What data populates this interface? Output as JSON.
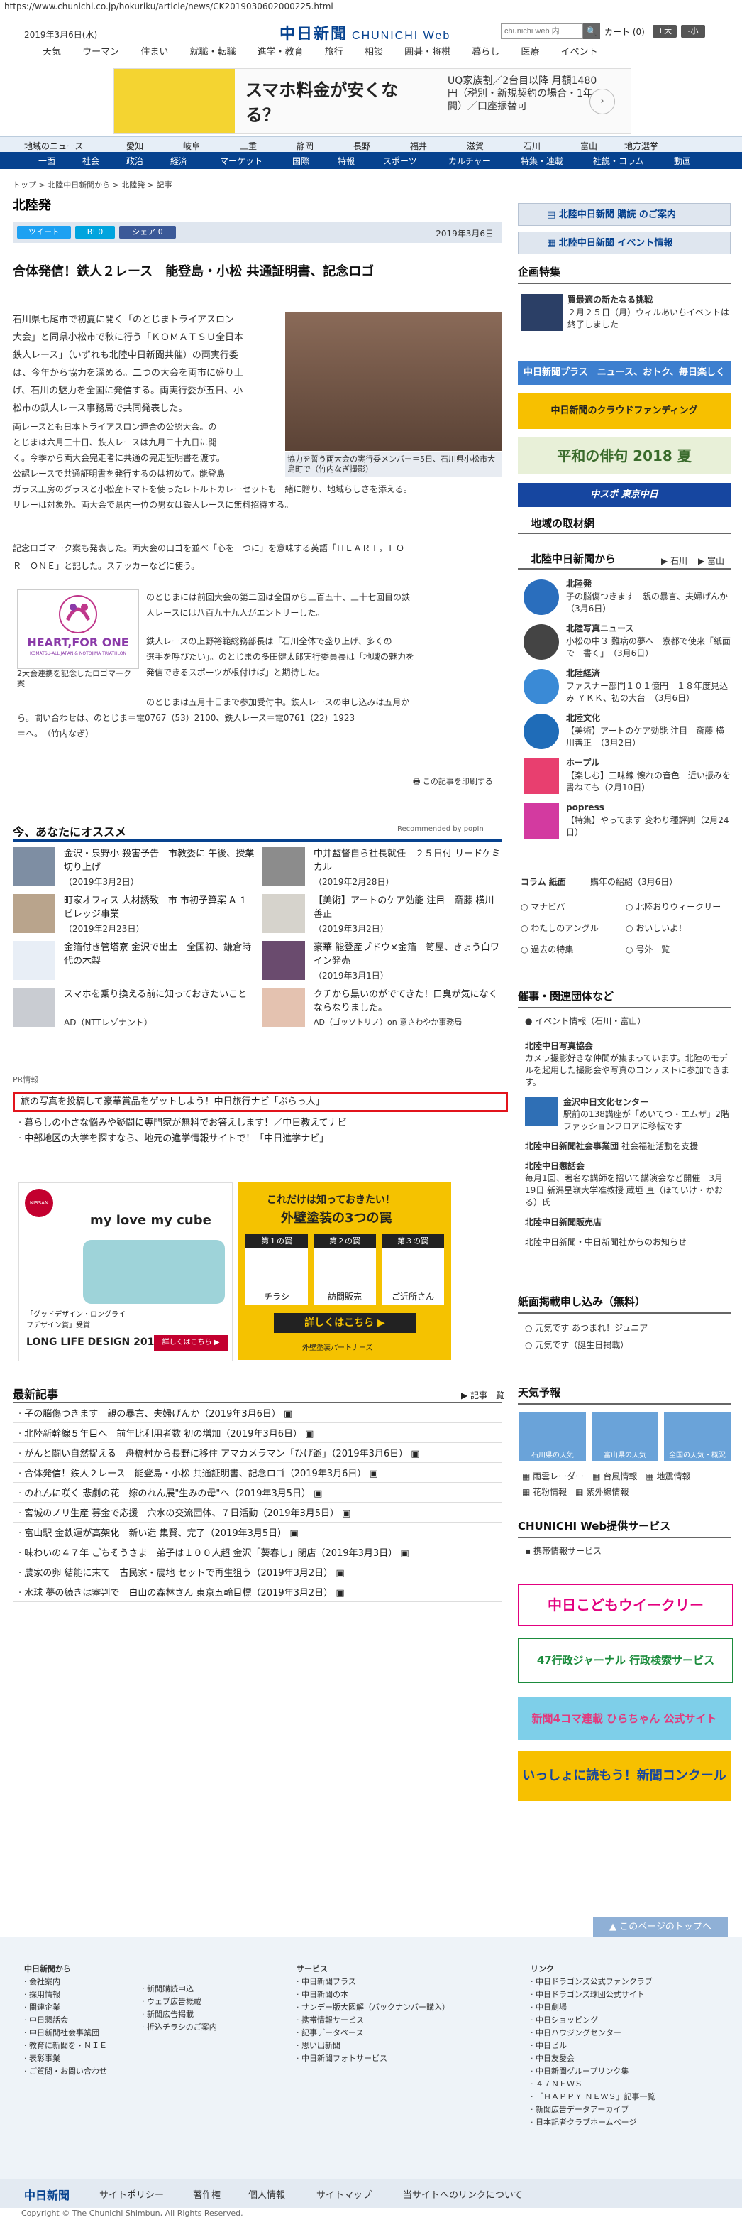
{
  "url": "https://www.chunichi.co.jp/hokuriku/article/news/CK2019030602000225.html",
  "header": {
    "date": "2019年3月6日(水)",
    "logo": "中日新聞",
    "logo_sub": "CHUNICHI Web",
    "search_placeholder": "chunichi web 内",
    "search_btn": "🔍",
    "cart": "カート (0)",
    "font_up": "+大",
    "font_down": "-小",
    "categories": [
      "天気",
      "ウーマン",
      "住まい",
      "就職・転職",
      "進学・教育",
      "旅行",
      "相談",
      "囲碁・将棋",
      "暮らし",
      "医療",
      "イベント"
    ]
  },
  "ad_top": {
    "title": "スマホ料金が安くなる？",
    "text": "UQ家族割／2台目以降 月額1480円（税別・新規契約の場合・1年間）／口座振替可"
  },
  "region_nav": [
    "地域のニュース",
    "愛知",
    "岐阜",
    "三重",
    "静岡",
    "長野",
    "福井",
    "滋賀",
    "石川",
    "富山",
    "地方選挙"
  ],
  "section_nav": [
    "一面",
    "社会",
    "政治",
    "経済",
    "マーケット",
    "国際",
    "特報",
    "スポーツ",
    "カルチャー",
    "特集・連載",
    "社説・コラム",
    "動画"
  ],
  "breadcrumb": "トップ > 北陸中日新聞から > 北陸発 > 記事",
  "section_title": "北陸発",
  "share": {
    "tweet": "ツイート",
    "hatena": "B! 0",
    "fb": "シェア 0"
  },
  "article": {
    "date": "2019年3月6日",
    "title": "合体発信！鉄人２レース　能登島・小松 共通証明書、記念ロゴ",
    "p1": [
      "石川県七尾市で初夏に開く「のとじまトライアスロン",
      "大会」と同県小松市で秋に行う「ＫＯＭＡＴＳＵ全日本",
      "鉄人レース」（いずれも北陸中日新聞共催）の両実行委",
      "は、今年から協力を深める。二つの大会を両市に盛り上",
      "げ、石川の魅力を全国に発信する。両実行委が五日、小",
      "松市の鉄人レース事務局で共同発表した。"
    ],
    "p2": [
      "両レースとも日本トライアスロン連合の公認大会。の",
      "とじまは六月三十日、鉄人レースは九月二十九日に開",
      "く。今季から両大会完走者に共通の完走証明書を渡す。",
      "公認レースで共通証明書を発行するのは初めて。能登島",
      "ガラス工房のグラスと小松産トマトを使ったレトルトカレーセットも一緒に贈り、地域らしさを添える。",
      "リレーは対象外。両大会で県内一位の男女は鉄人レースに無料招待する。"
    ],
    "p3": [
      "記念ロゴマーク案も発表した。両大会の口ゴを並べ「心を一つに」を意味する英語「ＨＥＡＲＴ，ＦＯ",
      "Ｒ　ＯＮＥ」と記した。ステッカーなどに使う。"
    ],
    "p4": [
      "のとじまには前回大会の第二回は全国から三百五十、三十七回目の鉄",
      "人レースには八百九十九人がエントリーした。"
    ],
    "p5": [
      "鉄人レースの上野裕範総務部長は「石川全体で盛り上げ、多くの",
      "選手を呼びたい」。のとじまの多田健太郎実行委員長は「地域の魅力を",
      "発信できるスポーツが根付けば」と期待した。"
    ],
    "p6": [
      "のとじまは五月十日まで参加受付中。鉄人レースの申し込みは五月か",
      "ら。問い合わせは、のとじま＝電0767（53）2100、鉄人レース＝電0761（22）1923",
      "＝へ。　（竹内なぎ）"
    ],
    "photo_caption": "協力を誓う両大会の実行委メンバー＝5日、石川県小松市大島町で（竹内なぎ撮影）",
    "logo_caption": "2大会連携を記念したロゴマーク案",
    "logo_line1": "HEART,FOR ONE",
    "logo_line2": "KOMATSU-ALL JAPAN & NOTOJIMA TRIATHLON",
    "print": "この記事を印刷する"
  },
  "recommend": {
    "heading": "今、あなたにオススメ",
    "powered": "Recommended by popIn",
    "items": [
      {
        "title": "金沢・泉野小 殺害予告　市教委に 午後、授業切り上げ",
        "date": "（2019年3月2日）"
      },
      {
        "title": "中井監督自ら社長就任　２５日付 リードケミカル",
        "date": "（2019年2月28日）"
      },
      {
        "title": "町家オフィス 人材誘致　市 市初予算案 A １ビレッジ事業",
        "date": "（2019年2月23日）"
      },
      {
        "title": "【美術】アートのケア効能 注目　斎藤 横川善正",
        "date": "（2019年3月2日）"
      },
      {
        "title": "金箔付き管塔寮 金沢で出土　全国初、鎌倉時代の木製",
        "date": ""
      },
      {
        "title": "豪華 能登産ブドウ×金箔　笥屋、きょう白ワイン発売",
        "date": "（2019年3月1日）"
      },
      {
        "title": "スマホを乗り換える前に知っておきたいこと",
        "date": "AD（NTTレゾナント）"
      },
      {
        "title": "クチから黒いのがでてきた！口臭が気になくならなりました。",
        "date": "AD（ゴッソトリノ）on 意さわやか事務局"
      }
    ]
  },
  "pr": {
    "heading": "PR情報",
    "items": [
      "旅の写真を投稿して豪華賞品をゲットしよう！中日旅行ナビ「ぷらっ人」",
      "暮らしの小さな悩みや疑問に専門家が無料でお答えします！／中日教えてナビ",
      "中部地区の大学を探すなら、地元の進学情報サイトで！「中日進学ナビ」"
    ]
  },
  "ads_mid": {
    "left_brand": "NISSAN",
    "left_title": "my love my cube",
    "left_sub": "「グッドデザイン・ロングライフデザイン賞」受賞",
    "left_sub2": "LONG LIFE DESIGN 2018",
    "left_btn": "詳しくはこちら ▶",
    "right_title": "これだけは知っておきたい！",
    "right_title2": "外壁塗装の3つの罠",
    "traps": [
      "第１の罠",
      "第２の罠",
      "第３の罠"
    ],
    "trap_labels": [
      "チラシ",
      "訪問販売",
      "ご近所さん"
    ],
    "right_btn": "詳しくはこちら ▶",
    "right_brand": "外壁塗装パートナーズ"
  },
  "latest": {
    "heading": "最新記事",
    "more": "記事一覧",
    "items": [
      "子の脳傷つきます　親の暴言、夫婦げんか（2019年3月6日）",
      "北陸新幹線５年目へ　前年比利用者数 初の増加（2019年3月6日）",
      "がんと闘い自然捉える　舟橋村から長野に移住 アマカメラマン「ひげ爺」（2019年3月6日）",
      "合体発信！鉄人２レース　能登島・小松 共通証明書、記念ロゴ（2019年3月6日）",
      "のれんに咲く 悲劇の花　嫁のれん展\"生みの母\"へ（2019年3月5日）",
      "宮城のノリ生産 募金で応援　穴水の交流団体、７日活動（2019年3月5日）",
      "富山駅 金鉄運が高架化　新い造 集賢、完了（2019年3月5日）",
      "味わいの４７年 ごちそうさま　弟子は１００人超 金沢「葵春し」閉店（2019年3月3日）",
      "農家の卵 結能に末て　古民家・農地 セットで再生狙う（2019年3月2日）",
      "水球 夢の続きは審判で　白山の森林さん 東京五輪目標（2019年3月2日）"
    ]
  },
  "sidebar": {
    "subscribe": "北陸中日新聞 購読 のご案内",
    "event": "北陸中日新聞 イベント情報",
    "feature_h": "企画特集",
    "feature_title": "買最適の新たなる挑戦",
    "feature_text": "２月２５日（月）ウィルあいちイベントは終了しました",
    "banners": [
      "中日新聞プラス　ニュース、おトク、毎日楽しく",
      "中日新聞のクラウドファンディング",
      "平和の俳句 2018 夏",
      "中スポ 東京中日"
    ],
    "local_h": "地域の取材網",
    "hoku_h": "北陸中日新聞から",
    "hoku_links": [
      "石川",
      "富山"
    ],
    "hoku_items": [
      {
        "label": "北陸発",
        "text": "子の脳傷つきます　親の暴言、夫婦げんか　（3月6日）"
      },
      {
        "label": "北陸写真ニュース",
        "text": "小松の中３ 難病の夢へ　寮都で使来「紙面で一書く」　（3月6日）"
      },
      {
        "label": "北陸経済",
        "text": "ファスナー部門１０１億円　１８年度見込み ＹＫＫ、初の大台　（3月6日）"
      },
      {
        "label": "北陸文化",
        "text": "【美術】アートのケア効能 注目　斎藤 横川善正　（3月2日）"
      },
      {
        "label": "ホープル",
        "text": "【楽しむ】三味線 懐れの音色　近い振みを書ねても（2月10日）"
      },
      {
        "label": "popress",
        "text": "【特集】やってます 変わり種評判（2月24日）"
      }
    ],
    "column_h": "コラム 紙面",
    "column_sub": "購年の紹紹（3月6日）",
    "links": [
      "マナビバ",
      "北陸おりウィークリー",
      "わたしのアングル",
      "おいしいよ！",
      "過去の特集",
      "号外一覧"
    ],
    "org_h": "催事・関連団体など",
    "event_label": "イベント情報（石川・富山）",
    "orgs": [
      {
        "name": "北陸中日写真協会",
        "text": "カメラ撮影好きな仲間が集まっています。北陸のモデルを起用した撮影会や写真のコンテストに参加できます。"
      },
      {
        "name": "金沢中日文化センター",
        "text": "駅前の138講座が「めいてつ・エムザ」2階 ファッションフロアに移転です"
      },
      {
        "name": "北陸中日新聞社会事業団",
        "text": "社会福祉活動を支援"
      },
      {
        "name": "北陸中日懇話会",
        "text": "毎月1回、著名な講師を招いて講演会など開催　3月19日 新潟星嶺大学准教授 蔵垣 直（ほていけ・かおる）氏"
      },
      {
        "name": "北陸中日新聞販売店",
        "text": ""
      },
      {
        "name": "北陸中日新聞・中日新聞社からのお知らせ",
        "text": ""
      }
    ],
    "apply_h": "紙面掲載申し込み（無料）",
    "apply_items": [
      "元気です あつまれ！ジュニア",
      "元気です（誕生日掲載）"
    ],
    "weather_h": "天気予報",
    "weather": [
      "石川県の天気",
      "富山県の天気",
      "全国の天気・概況"
    ],
    "weather_links": [
      "雨雲レーダー",
      "台風情報",
      "地震情報",
      "花粉情報",
      "紫外線情報"
    ],
    "services_h": "CHUNICHI Web提供サービス",
    "services_sub": "携帯情報サービス",
    "banners2": [
      "中日こどもウイークリー",
      "47行政ジャーナル 行政検索サービス",
      "新聞4コマ連載 ひらちゃん 公式サイト",
      "いっしょに読もう！新聞コンクール"
    ],
    "pagetop": "このページのトップへ"
  },
  "footer": {
    "col1_h": "中日新聞から",
    "col1": [
      "会社案内",
      "採用情報",
      "関連企業",
      "中日懇話会",
      "中日新聞社会事業団",
      "教育に新聞を・ＮＩＥ",
      "表彰事業",
      "ご質問・お問い合わせ"
    ],
    "col2": [
      "新聞購読申込",
      "ウェブ広告概載",
      "新聞広告掲載",
      "折込チラシのご案内"
    ],
    "col3_h": "サービス",
    "col3": [
      "中日新聞プラス",
      "中日新聞の本",
      "サンデー版大図解（バックナンバー購入）",
      "携帯情報サービス",
      "記事データベース",
      "思い出新聞",
      "中日新聞フォトサービス"
    ],
    "col4_h": "リンク",
    "col4": [
      "中日ドラゴンズ公式ファンクラブ",
      "中日ドラゴンズ球団公式サイト",
      "中日劇場",
      "中日ショッピング",
      "中日ハウジングセンター",
      "中日ビル",
      "中日友愛会",
      "中日新聞グループリンク集",
      "４７ＮＥＷＳ",
      "「ＨＡＰＰＹ ＮＥＷＳ」記事一覧",
      "新聞広告データアーカイブ",
      "日本記者クラブホームページ"
    ],
    "bottom_logo": "中日新聞",
    "bottom_links": [
      "サイトポリシー",
      "著作権",
      "個人情報",
      "サイトマップ",
      "当サイトへのリンクについて"
    ],
    "copyright": "Copyright © The Chunichi Shimbun, All Rights Reserved."
  }
}
